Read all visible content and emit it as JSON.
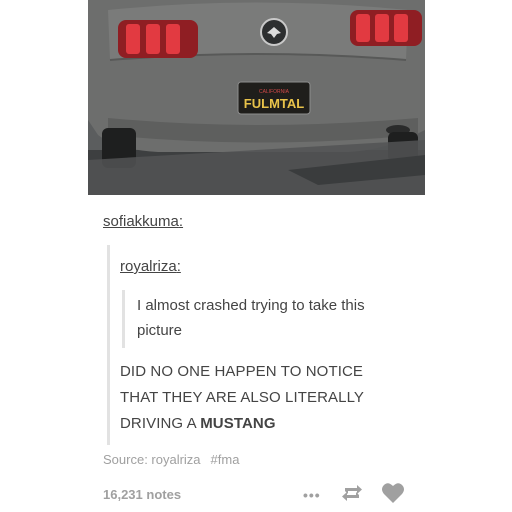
{
  "photo": {
    "alt_description_visible_text": "CALIFORNIA",
    "plate_text": "FULMTAL",
    "colors": {
      "body": "#6b6c6b",
      "plate": "#1f1e1b",
      "plate_text": "#e9c34a",
      "taillight": "#d12d33"
    }
  },
  "post": {
    "author": "sofiakkuma",
    "author_colon": ":",
    "reblog": {
      "author": "royalriza",
      "author_colon": ":",
      "text_line1": "I almost crashed trying to take this",
      "text_line2": "picture"
    },
    "comment": {
      "line1": "DID NO ONE HAPPEN TO NOTICE",
      "line2": "THAT THEY ARE ALSO LITERALLY",
      "line3_prefix": "DRIVING A ",
      "line3_bold": "MUSTANG"
    },
    "source_label": "Source: royalriza",
    "tag": "#fma",
    "notes": "16,231 notes"
  },
  "icons": {
    "more": "more-dots-icon",
    "reblog": "reblog-icon",
    "like": "heart-icon"
  },
  "colors": {
    "text": "#444444",
    "muted": "#a0a0a0",
    "bar": "#e2e2e2"
  }
}
